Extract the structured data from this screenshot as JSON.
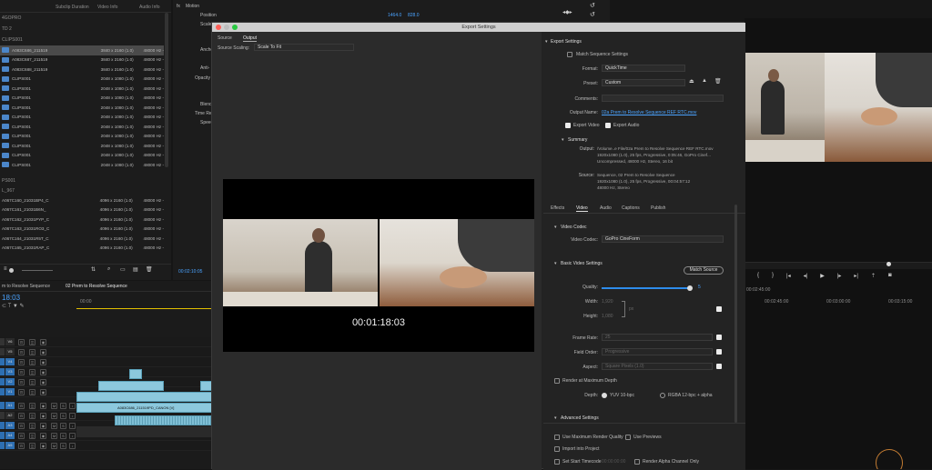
{
  "project": {
    "headers": {
      "duration": "Subclip Duration",
      "video_info": "Video Info",
      "audio_info": "Audio Info"
    },
    "group_labels": [
      "4GOPRO",
      "TD 2",
      "CLIPS001",
      "PS001",
      "L_967"
    ],
    "rows": [
      {
        "name": "A083C686_211519",
        "video": "3840 x 2160 (1.0)",
        "audio": "48000 Hz -",
        "selected": true
      },
      {
        "name": "A083C687_211519",
        "video": "3840 x 2160 (1.0)",
        "audio": "48000 Hz -",
        "selected": false
      },
      {
        "name": "A083C688_211519",
        "video": "3840 x 2160 (1.0)",
        "audio": "48000 Hz -",
        "selected": false
      },
      {
        "name": "CLIPS001",
        "video": "2048 x 1080 (1.0)",
        "audio": "48000 Hz -",
        "selected": false
      },
      {
        "name": "CLIPS001",
        "video": "2048 x 1080 (1.0)",
        "audio": "48000 Hz -",
        "selected": false
      },
      {
        "name": "CLIPS001",
        "video": "2048 x 1080 (1.0)",
        "audio": "48000 Hz -",
        "selected": false
      },
      {
        "name": "CLIPS001",
        "video": "2048 x 1080 (1.0)",
        "audio": "48000 Hz -",
        "selected": false
      },
      {
        "name": "CLIPS001",
        "video": "2048 x 1080 (1.0)",
        "audio": "48000 Hz -",
        "selected": false
      },
      {
        "name": "CLIPS001",
        "video": "2048 x 1080 (1.0)",
        "audio": "48000 Hz -",
        "selected": false
      },
      {
        "name": "CLIPS001",
        "video": "2048 x 1080 (1.0)",
        "audio": "48000 Hz -",
        "selected": false
      },
      {
        "name": "CLIPS001",
        "video": "2048 x 1080 (1.0)",
        "audio": "48000 Hz -",
        "selected": false
      },
      {
        "name": "CLIPS001",
        "video": "2048 x 1080 (1.0)",
        "audio": "48000 Hz -",
        "selected": false
      },
      {
        "name": "CLIPS001",
        "video": "2048 x 1080 (1.0)",
        "audio": "48000 Hz -",
        "selected": false
      }
    ],
    "rows2": [
      {
        "name": "A067C160_21031BP4_C",
        "video": "4096 x 2160 (1.0)",
        "audio": "48000 Hz -"
      },
      {
        "name": "A067C161_21031B6N_",
        "video": "4096 x 2160 (1.0)",
        "audio": "48000 Hz -"
      },
      {
        "name": "A067C162_21031PYP_C",
        "video": "4096 x 2160 (1.0)",
        "audio": "48000 Hz -"
      },
      {
        "name": "A067C163_21031RO3_C",
        "video": "4096 x 2160 (1.0)",
        "audio": "48000 Hz -"
      },
      {
        "name": "A067C164_21031R5T_C",
        "video": "4096 x 2160 (1.0)",
        "audio": "48000 Hz -"
      },
      {
        "name": "A067C165_21031RAP_C",
        "video": "4096 x 2160 (1.0)",
        "audio": "48000 Hz -"
      }
    ]
  },
  "effect_controls": {
    "items": [
      "Motion",
      "Position",
      "Scale",
      "Anchor",
      "Anti-",
      "Opacity",
      "Blend",
      "Time Re",
      "Speed"
    ],
    "position_values": [
      "1464.0",
      "828.0"
    ],
    "timecode": "00:02:10:05"
  },
  "timeline": {
    "tab": "02 Prem to Resolve Sequence",
    "seq_name": "m to Resolve Sequence",
    "timecode": "18:03",
    "ruler": [
      "00:00",
      "00:02:45:00",
      "00:03:00:00",
      "00:03:15:00"
    ],
    "tracks": [
      "V6",
      "V5",
      "V4",
      "V3",
      "V2",
      "V1",
      "A1",
      "A2",
      "A3",
      "A4",
      "A5"
    ],
    "clip_label": "A083C686_211519PD_CANON [V]"
  },
  "dialog": {
    "title": "Export Settings",
    "tabs": {
      "source": "Source",
      "output": "Output"
    },
    "source_scaling_label": "Source Scaling:",
    "source_scaling_value": "Scale To Fit",
    "preview_timecode": "00:01:18:03",
    "export_settings": {
      "header": "Export Settings",
      "match_sequence": "Match Sequence Settings",
      "format_label": "Format:",
      "format_value": "QuickTime",
      "preset_label": "Preset:",
      "preset_value": "Custom",
      "comments_label": "Comments:",
      "output_name_label": "Output Name:",
      "output_name_value": "02a Prem to Resolve Sequence REF RTC.mov",
      "export_video": "Export Video",
      "export_audio": "Export Audio"
    },
    "summary": {
      "header": "Summary",
      "output_label": "Output:",
      "output_lines": [
        "/Volume..e File/02a Prem to Resolve Sequence REF RTC.mov",
        "1920x1080 (1.0), 25 fps, Progressive, 0:05:46, GoPro Cinef...",
        "Uncompressed, 48000 Hz, Stereo, 16 bit"
      ],
      "source_label": "Source:",
      "source_lines": [
        "Sequence, 02 Prem to Resolve Sequence",
        "1920x1080 (1.0), 25 fps, Progressive, 00:04:57:12",
        "48000 Hz, Stereo"
      ]
    },
    "settings_tabs": [
      "Effects",
      "Video",
      "Audio",
      "Captions",
      "Publish"
    ],
    "video_codec": {
      "header": "Video Codec",
      "label": "Video Codec:",
      "value": "GoPro CineForm"
    },
    "basic_video": {
      "header": "Basic Video Settings",
      "match_source": "Match Source",
      "quality_label": "Quality:",
      "quality_value": "5",
      "width_label": "Width:",
      "width_value": "1,920",
      "height_label": "Height:",
      "height_value": "1,080",
      "px_label": "px",
      "frame_rate_label": "Frame Rate:",
      "frame_rate_value": "25",
      "field_order_label": "Field Order:",
      "field_order_value": "Progressive",
      "aspect_label": "Aspect:",
      "aspect_value": "Square Pixels (1.0)",
      "render_max_depth": "Render at Maximum Depth",
      "depth_label": "Depth:",
      "depth_opt1": "YUV 10-bpc",
      "depth_opt2": "RGBA 12-bpc + alpha"
    },
    "advanced_header": "Advanced Settings",
    "bottom": {
      "use_max_render": "Use Maximum Render Quality",
      "use_previews": "Use Previews",
      "import_into_project": "Import into Project",
      "set_start_timecode": "Set Start Timecode",
      "start_tc_value": "00:00:00:00",
      "render_alpha": "Render Alpha Channel Only"
    }
  },
  "program": {
    "ruler": [
      "00:02:45:00",
      "00:03:00:00",
      "00:03:15:00"
    ]
  },
  "colors": {
    "accent": "#2d8ceb",
    "clip_video": "#8cc8dd",
    "clip_audio": "#7fbfd5",
    "selected_track": "#2e6fb2",
    "record_ring": "#c07a32"
  }
}
